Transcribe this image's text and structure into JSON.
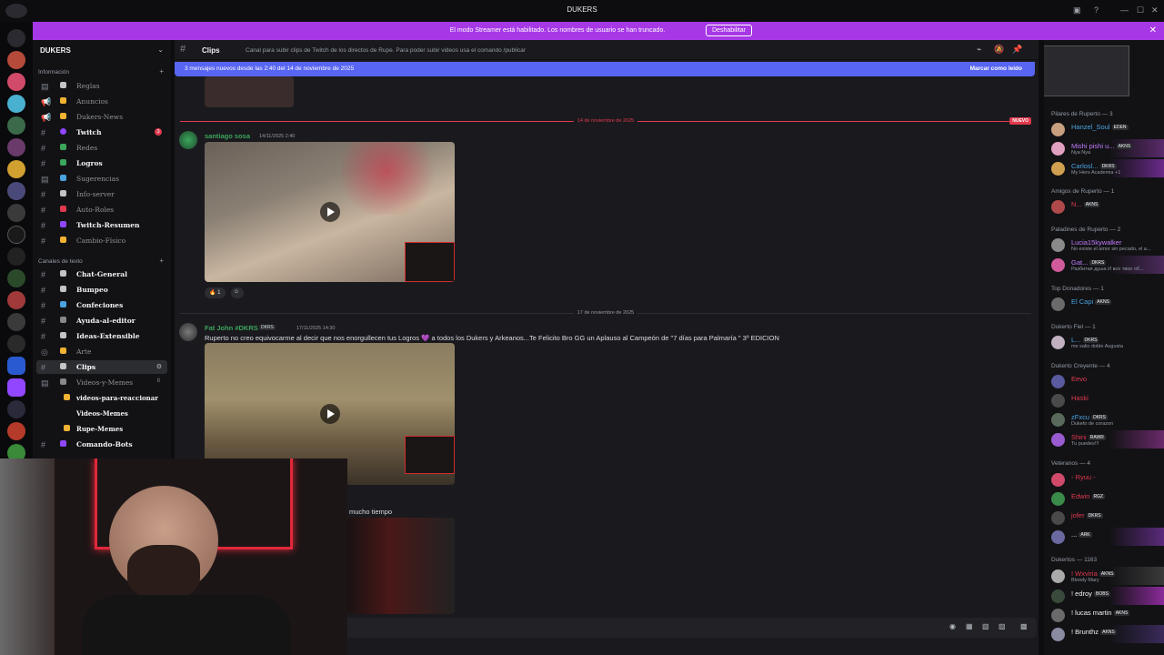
{
  "window": {
    "title": "DUKERS",
    "controls": [
      "—",
      "☐",
      "✕"
    ]
  },
  "streamer_banner": {
    "message": "El modo Streamer está habilitado. Los nombres de usuario se han truncado.",
    "disable_label": "Deshabilitar"
  },
  "server": {
    "name": "DUKERS",
    "categories": [
      {
        "label": "Información"
      },
      {
        "label": "Canales de texto"
      }
    ],
    "channels": [
      {
        "label": "Reglas",
        "unread": false,
        "emoji_color": "#c4c4c4"
      },
      {
        "label": "Anuncios",
        "unread": false,
        "emoji_color": "#f0b232"
      },
      {
        "label": "Dukers-News",
        "unread": false,
        "emoji_color": "#f0b232"
      },
      {
        "label": "Twitch",
        "unread": true,
        "count": "3",
        "emoji_color": "#9146ff"
      },
      {
        "label": "Redes",
        "unread": false,
        "emoji_color": "#3ba55c"
      },
      {
        "label": "Logros",
        "unread": true,
        "emoji_color": "#3ba55c"
      },
      {
        "label": "Sugerencias",
        "unread": false,
        "emoji_color": "#4aa3df"
      },
      {
        "label": "Info-server",
        "unread": false,
        "emoji_color": "#c4c4c4"
      },
      {
        "label": "Auto-Roles",
        "unread": false,
        "emoji_color": "#e0394d"
      },
      {
        "label": "Twitch-Resumen",
        "unread": true,
        "emoji_color": "#9146ff"
      },
      {
        "label": "Cambio-Físico",
        "unread": false,
        "emoji_color": "#f0b232"
      },
      {
        "label": "Chat-General",
        "unread": true,
        "emoji_color": "#c4c4c4"
      },
      {
        "label": "Bumpeo",
        "unread": true,
        "emoji_color": "#c4c4c4"
      },
      {
        "label": "Confeciones",
        "unread": true,
        "emoji_color": "#4aa3df"
      },
      {
        "label": "Ayuda-al-editor",
        "unread": true,
        "emoji_color": "#888"
      },
      {
        "label": "Ideas-Extensible",
        "unread": true,
        "emoji_color": "#c4c4c4"
      },
      {
        "label": "Arte",
        "unread": false,
        "emoji_color": "#f0b232"
      },
      {
        "label": "Clips",
        "unread": true,
        "active": true,
        "emoji_color": "#c4c4c4"
      },
      {
        "label": "Videos-y-Memes",
        "unread": false,
        "count_text": "8",
        "emoji_color": "#888"
      },
      {
        "label": "videos-para-reaccionar",
        "unread": true,
        "emoji_color": "#f0b232"
      },
      {
        "label": "Videos-Memes",
        "unread": true,
        "emoji_color": "#c4c4c4"
      },
      {
        "label": "Rupe-Memes",
        "unread": true,
        "emoji_color": "#f0b232"
      },
      {
        "label": "Comando-Bots",
        "unread": true,
        "emoji_color": "#9146ff"
      }
    ]
  },
  "channel_header": {
    "name": "Clips",
    "topic": "Canal para subir clips de Twitch de los directos de Rupe. Para poder subir videos usa el comando /publicar"
  },
  "new_messages_bar": {
    "text": "3 mensajes nuevos desde las 2:40 del 14 de noviembre de 2025",
    "mark_read": "Marcar como leído"
  },
  "messages": {
    "divider1": "14 de noviembre de 2025",
    "new_label": "NUEVO",
    "m1": {
      "author": "santiago sosa",
      "timestamp": "14/11/2025 2:40",
      "reaction_count": "1"
    },
    "divider2": "17 de noviembre de 2025",
    "m2": {
      "author": "Fat John #DKRS",
      "badge": "DKRS",
      "timestamp": "17/11/2025 14:30",
      "text": "Ruperto  no creo equivocarme al decir que nos enorgullecen  tus Logros 💜 a todos los Dukers y Arkeanos...Te Felicito Bro GG un Aplauso  al Campeón de \"7 días para Palmaría \" 3º EDICION"
    },
    "m3": {
      "text": "mucho tiempo"
    }
  },
  "members": {
    "groups": [
      {
        "label": "Pilares de Ruperto — 3",
        "items": [
          {
            "name": "Hanzel_Soul",
            "tag": "EDEN",
            "color": "#4aa3df",
            "sub": ""
          },
          {
            "name": "Mishi pishi u...",
            "tag": "AKNS",
            "color": "#c27cff",
            "sub": "Nya Nya"
          },
          {
            "name": "Carlosl...",
            "tag": "DKRS",
            "color": "#4aa3df",
            "sub": "My Hero Academia +1"
          }
        ]
      },
      {
        "label": "Amigos de Ruperto — 1",
        "items": [
          {
            "name": "N...",
            "tag": "AKNS",
            "color": "#e0394d",
            "sub": ""
          }
        ]
      },
      {
        "label": "Paladines de Ruperto — 2",
        "items": [
          {
            "name": "Lucia15kywalker",
            "tag": "",
            "color": "#c27cff",
            "sub": "No existe el amor sin pecado, el a..."
          },
          {
            "name": "Gat...",
            "tag": "DKRS",
            "color": "#c27cff",
            "sub": "Разбитая душа И все твое об..."
          }
        ]
      },
      {
        "label": "Top Donadores — 1",
        "items": [
          {
            "name": "El Capi",
            "tag": "AKNS",
            "color": "#4aa3df",
            "sub": ""
          }
        ]
      },
      {
        "label": "Dukerto Fiel — 1",
        "items": [
          {
            "name": "L...",
            "tag": "DKRS",
            "color": "#4aa3df",
            "sub": "me salio doble Augusta"
          }
        ]
      },
      {
        "label": "Dukerto Creyente — 4",
        "items": [
          {
            "name": "Eevo",
            "tag": "",
            "color": "#e0394d",
            "sub": ""
          },
          {
            "name": "Haski",
            "tag": "",
            "color": "#e0394d",
            "sub": ""
          },
          {
            "name": "zFxcu",
            "tag": "DKRS",
            "color": "#4aa3df",
            "sub": "Duketo de corazon"
          },
          {
            "name": "Shini",
            "tag": "RAWR",
            "color": "#e0394d",
            "sub": "Tu puedes!!!"
          }
        ]
      },
      {
        "label": "Veteranos — 4",
        "items": [
          {
            "name": "- Ryuu -",
            "tag": "",
            "color": "#e0394d",
            "sub": ""
          },
          {
            "name": "Edwin",
            "tag": "RGZ",
            "color": "#e0394d",
            "sub": ""
          },
          {
            "name": "jofer",
            "tag": "DKRS",
            "color": "#e0394d",
            "sub": ""
          },
          {
            "name": "...",
            "tag": "ARK",
            "color": "#f2f3f5",
            "sub": ""
          }
        ]
      },
      {
        "label": "Dukertos — 1163",
        "items": [
          {
            "name": "! Wxviria",
            "tag": "AKNS",
            "color": "#e0394d",
            "sub": "Bloody Mary"
          },
          {
            "name": "! edroy",
            "tag": "BOBS",
            "color": "#f2f3f5",
            "sub": ""
          },
          {
            "name": "! lucas martin",
            "tag": "AKNS",
            "color": "#f2f3f5",
            "sub": ""
          },
          {
            "name": "! Brunthz",
            "tag": "AKNS",
            "color": "#f2f3f5",
            "sub": ""
          }
        ]
      }
    ]
  },
  "colors": {
    "accent": "#5865f2",
    "streamer": "#a638e6",
    "unread_red": "#e0394d",
    "twitch": "#9146ff"
  },
  "icons": [
    "streamer-icon",
    "help-icon",
    "hash-icon",
    "threads-icon",
    "mute-icon",
    "pin-icon",
    "members-icon",
    "search-icon",
    "play-icon",
    "gift-icon",
    "gif-icon",
    "sticker-icon",
    "emoji-icon",
    "apps-icon"
  ]
}
